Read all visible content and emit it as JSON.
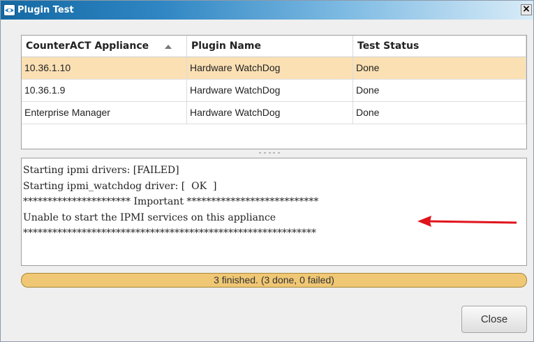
{
  "window": {
    "title": "Plugin Test",
    "close_glyph": "×"
  },
  "table": {
    "columns": [
      "CounterACT Appliance",
      "Plugin Name",
      "Test Status"
    ],
    "sort_column": "CounterACT Appliance",
    "sort_direction": "ascending",
    "rows": [
      {
        "appliance": "10.36.1.10",
        "plugin": "Hardware WatchDog",
        "status": "Done",
        "selected": true
      },
      {
        "appliance": "10.36.1.9",
        "plugin": "Hardware WatchDog",
        "status": "Done",
        "selected": false
      },
      {
        "appliance": "Enterprise Manager",
        "plugin": "Hardware WatchDog",
        "status": "Done",
        "selected": false
      }
    ]
  },
  "log": {
    "lines": [
      "Starting ipmi drivers: [FAILED]",
      "Starting ipmi_watchdog driver: [  OK  ]",
      "********************** Important ***************************",
      "Unable to start the IPMI services on this appliance",
      "************************************************************"
    ],
    "annotation_color": "#e0141b"
  },
  "progress": {
    "text": "3 finished. (3 done, 0 failed)",
    "fraction": 1.0
  },
  "buttons": {
    "close": "Close"
  },
  "colors": {
    "selected_row": "#fbe0b4",
    "progress_fill": "#f0c774",
    "titlebar": "#1469a3"
  }
}
